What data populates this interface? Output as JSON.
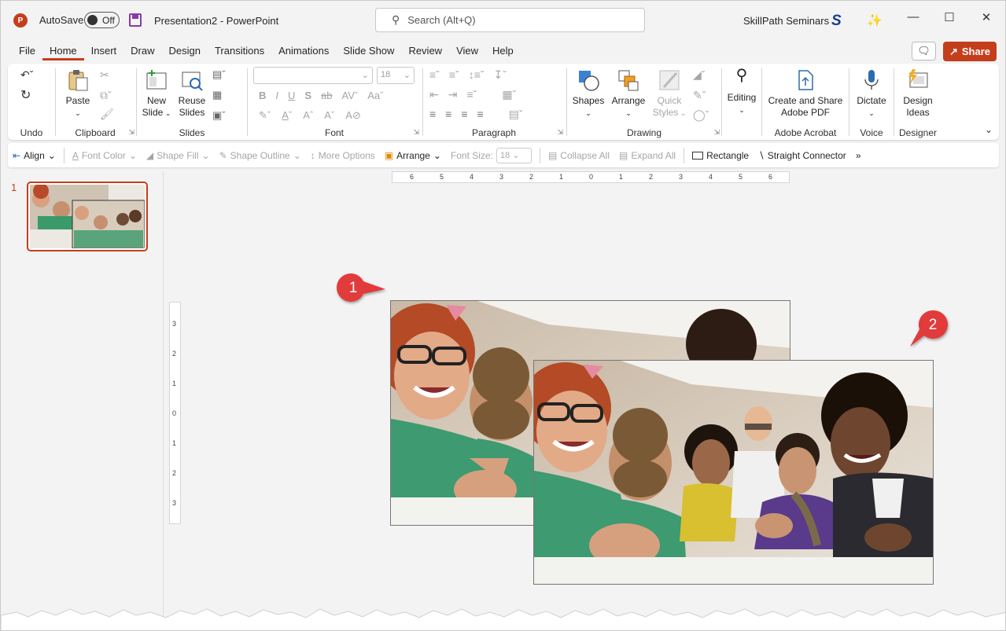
{
  "titlebar": {
    "app_icon": "P",
    "autosave_label": "AutoSave",
    "autosave_state": "Off",
    "title": "Presentation2  -  PowerPoint",
    "search_placeholder": "Search (Alt+Q)",
    "account_name": "SkillPath Seminars",
    "account_avatar": "S"
  },
  "menu_tabs": [
    "File",
    "Home",
    "Insert",
    "Draw",
    "Design",
    "Transitions",
    "Animations",
    "Slide Show",
    "Review",
    "View",
    "Help"
  ],
  "share_label": "Share",
  "ribbon": {
    "undo": {
      "group": "Undo"
    },
    "clipboard": {
      "paste": "Paste",
      "group": "Clipboard"
    },
    "slides": {
      "new_slide_1": "New",
      "new_slide_2": "Slide",
      "reuse_1": "Reuse",
      "reuse_2": "Slides",
      "group": "Slides"
    },
    "font": {
      "size": "18",
      "group": "Font"
    },
    "paragraph": {
      "group": "Paragraph"
    },
    "drawing": {
      "shapes": "Shapes",
      "arrange": "Arrange",
      "quick_styles_1": "Quick",
      "quick_styles_2": "Styles",
      "group": "Drawing"
    },
    "editing": {
      "label": "Editing"
    },
    "adobe": {
      "line1": "Create and Share",
      "line2": "Adobe PDF",
      "group": "Adobe Acrobat"
    },
    "voice": {
      "dictate": "Dictate",
      "group": "Voice"
    },
    "designer": {
      "line1": "Design",
      "line2": "Ideas",
      "group": "Designer"
    }
  },
  "qat": {
    "align": "Align",
    "font_color": "Font Color",
    "shape_fill": "Shape Fill",
    "shape_outline": "Shape Outline",
    "more_options": "More Options",
    "arrange": "Arrange",
    "font_size_label": "Font Size:",
    "font_size_value": "18",
    "collapse_all": "Collapse All",
    "expand_all": "Expand All",
    "rectangle": "Rectangle",
    "straight_connector": "Straight Connector",
    "overflow": "»"
  },
  "slides_pane": {
    "slide_number": "1"
  },
  "hruler_labels": [
    "6",
    "5",
    "4",
    "3",
    "2",
    "1",
    "0",
    "1",
    "2",
    "3",
    "4",
    "5",
    "6"
  ],
  "vruler_labels": [
    "3",
    "2",
    "1",
    "0",
    "1",
    "2",
    "3"
  ],
  "callouts": [
    "1",
    "2"
  ],
  "colors": {
    "accent": "#c43e1c",
    "callout": "#e23b3b"
  }
}
